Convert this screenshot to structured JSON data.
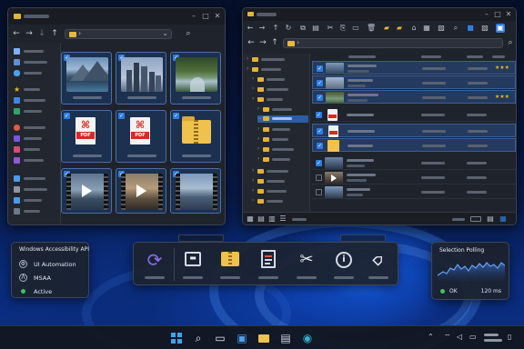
{
  "accessibility_panel": {
    "title": "Windows Accessibility API",
    "items": [
      {
        "label": "UI Automation",
        "icon": "ui-automation-icon"
      },
      {
        "label": "MSAA",
        "icon": "msaa-icon"
      },
      {
        "label": "Active",
        "icon": "status-dot-icon"
      }
    ],
    "status_color": "#3fc35b"
  },
  "polling_panel": {
    "title": "Selection Polling",
    "status": "OK",
    "interval": "120 ms",
    "line_color": "#6aa9ff"
  },
  "dock": {
    "items": [
      {
        "icon": "sync-icon"
      },
      {
        "icon": "archive-icon"
      },
      {
        "icon": "zip-folder-icon"
      },
      {
        "icon": "document-icon"
      },
      {
        "icon": "scissors-icon"
      },
      {
        "icon": "info-icon"
      },
      {
        "icon": "tag-icon"
      }
    ]
  },
  "colors": {
    "accent": "#2f7de1",
    "folder": "#e2b13a",
    "pdf_red": "#d72a22",
    "selection": "#243a5e"
  },
  "left_window": {
    "tiles": [
      {
        "kind": "image",
        "icon": "mountain-lake-image-icon"
      },
      {
        "kind": "image",
        "icon": "city-skyline-image-icon"
      },
      {
        "kind": "image",
        "icon": "forest-stream-image-icon"
      },
      {
        "kind": "pdf",
        "label": "PDF"
      },
      {
        "kind": "pdf",
        "label": "PDF"
      },
      {
        "kind": "zip",
        "icon": "zip-folder-icon"
      },
      {
        "kind": "video",
        "icon": "video-file-icon"
      },
      {
        "kind": "video",
        "icon": "video-file-icon"
      },
      {
        "kind": "video",
        "icon": "video-file-icon"
      }
    ]
  },
  "right_window": {
    "rating_rows": [
      1,
      3
    ]
  }
}
